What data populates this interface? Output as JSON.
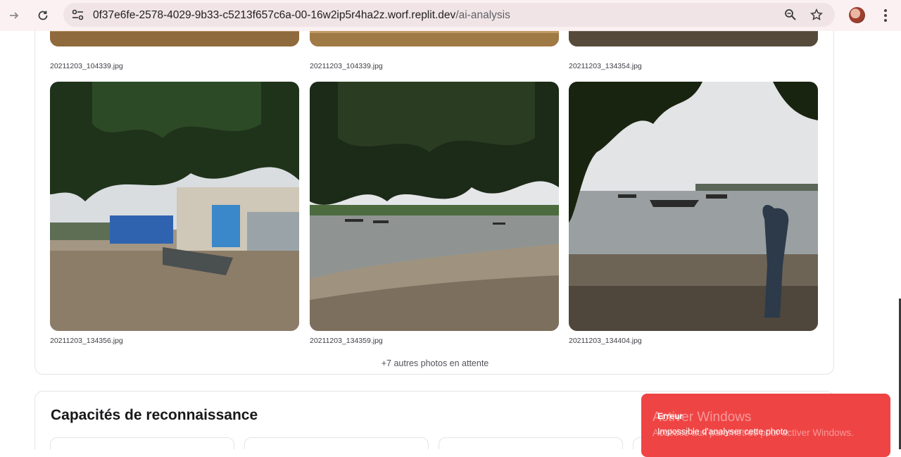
{
  "browser": {
    "url_host": "0f37e6fe-2578-4029-9b33-c5213f657c6a-00-16w2ip5r4ha2z.worf.replit.dev",
    "url_path": "/ai-analysis",
    "icons": [
      "forward-icon",
      "reload-icon",
      "site-settings-icon",
      "zoom-icon",
      "bookmark-star-icon",
      "profile-avatar-icon",
      "menu-icon"
    ]
  },
  "photos": {
    "top_row": [
      "20211203_104339.jpg",
      "20211203_104339.jpg",
      "20211203_134354.jpg"
    ],
    "second_row": [
      "20211203_134356.jpg",
      "20211203_134359.jpg",
      "20211203_134404.jpg"
    ],
    "pending_text": "+7 autres photos en attente"
  },
  "capabilities": {
    "title": "Capacités de reconnaissance"
  },
  "toast": {
    "title": "Erreur",
    "message": "Impossible d'analyser cette photo",
    "color": "#ef4444"
  },
  "watermark": {
    "title": "Activer Windows",
    "subtitle": "Accédez aux paramètres pour activer Windows."
  }
}
